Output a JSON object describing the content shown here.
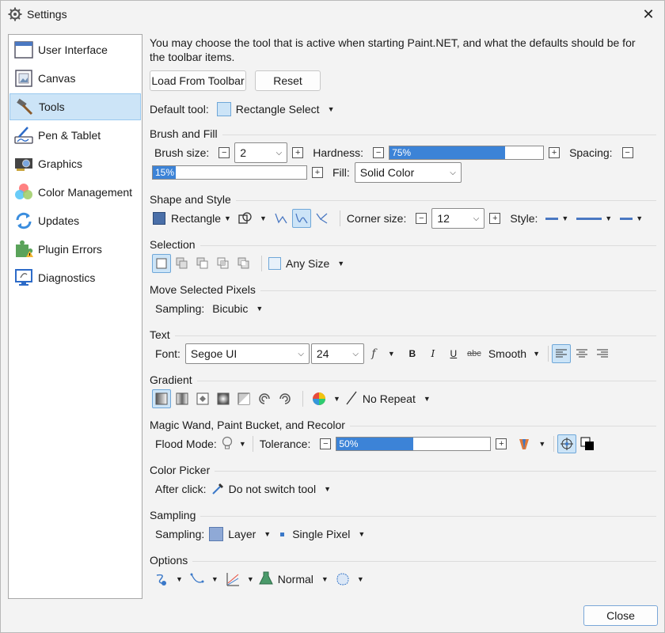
{
  "window": {
    "title": "Settings",
    "close_glyph": "✕"
  },
  "sidebar": {
    "items": [
      {
        "label": "User Interface",
        "icon": "window-icon"
      },
      {
        "label": "Canvas",
        "icon": "picture-icon"
      },
      {
        "label": "Tools",
        "icon": "hammer-icon",
        "selected": true
      },
      {
        "label": "Pen & Tablet",
        "icon": "pen-tablet-icon"
      },
      {
        "label": "Graphics",
        "icon": "gpu-icon"
      },
      {
        "label": "Color Management",
        "icon": "color-wheel-icon"
      },
      {
        "label": "Updates",
        "icon": "refresh-icon"
      },
      {
        "label": "Plugin Errors",
        "icon": "puzzle-warning-icon"
      },
      {
        "label": "Diagnostics",
        "icon": "monitor-icon"
      }
    ]
  },
  "intro": "You may choose the tool that is active when starting Paint.NET, and what the defaults should be for the toolbar items.",
  "buttons": {
    "load": "Load From Toolbar",
    "reset": "Reset",
    "close": "Close"
  },
  "default_tool": {
    "label": "Default tool:",
    "value": "Rectangle Select"
  },
  "brush": {
    "heading": "Brush and Fill",
    "size_label": "Brush size:",
    "size_value": "2",
    "hardness_label": "Hardness:",
    "hardness_text": "75%",
    "hardness": 0.75,
    "spacing_label": "Spacing:",
    "spacing_text": "15%",
    "spacing": 0.15,
    "fill_label": "Fill:",
    "fill_value": "Solid Color"
  },
  "shape": {
    "heading": "Shape and Style",
    "shape_value": "Rectangle",
    "corner_label": "Corner size:",
    "corner_value": "12",
    "style_label": "Style:"
  },
  "selection": {
    "heading": "Selection",
    "size_value": "Any Size"
  },
  "move": {
    "heading": "Move Selected Pixels",
    "sampling_label": "Sampling:",
    "sampling_value": "Bicubic"
  },
  "text": {
    "heading": "Text",
    "font_label": "Font:",
    "font_value": "Segoe UI",
    "size_value": "24",
    "bold": "B",
    "italic": "I",
    "underline": "U",
    "strike": "abc",
    "smooth": "Smooth"
  },
  "gradient": {
    "heading": "Gradient",
    "repeat_value": "No Repeat"
  },
  "magic": {
    "heading": "Magic Wand, Paint Bucket, and Recolor",
    "flood_label": "Flood Mode:",
    "tolerance_label": "Tolerance:",
    "tolerance_text": "50%",
    "tolerance": 0.5
  },
  "picker": {
    "heading": "Color Picker",
    "after_label": "After click:",
    "after_value": "Do not switch tool"
  },
  "sampling": {
    "heading": "Sampling",
    "label": "Sampling:",
    "layer_value": "Layer",
    "pixel_value": "Single Pixel"
  },
  "options": {
    "heading": "Options",
    "blend_value": "Normal"
  },
  "colors": {
    "accent": "#3c83d7",
    "selected_bg": "#cce4f7"
  }
}
